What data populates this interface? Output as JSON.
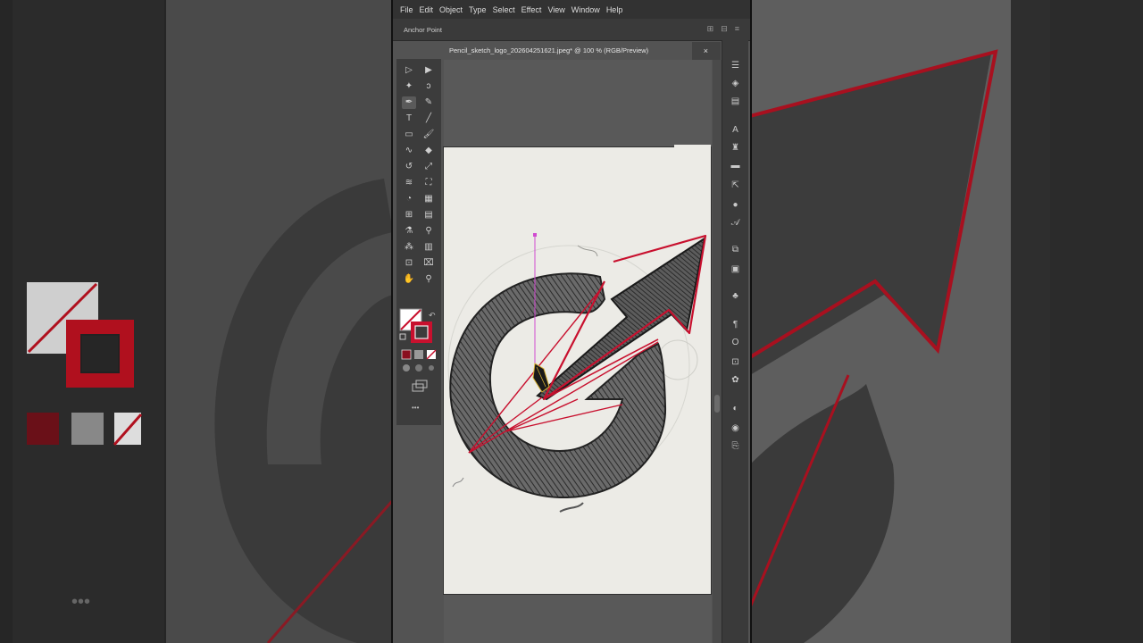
{
  "menubar": {
    "items": [
      "File",
      "Edit",
      "Object",
      "Type",
      "Select",
      "Effect",
      "View",
      "Window",
      "Help"
    ]
  },
  "control_bar": {
    "label": "Anchor Point"
  },
  "document": {
    "tab_title": "Pencil_sketch_logo_202604251621.jpeg* @ 100 % (RGB/Preview)",
    "close_glyph": "×"
  },
  "toolbar": {
    "tools": [
      {
        "name": "selection-tool-icon",
        "glyph": "▷"
      },
      {
        "name": "direct-selection-tool-icon",
        "glyph": "▶"
      },
      {
        "name": "magic-wand-tool-icon",
        "glyph": "✦"
      },
      {
        "name": "lasso-tool-icon",
        "glyph": "ↄ"
      },
      {
        "name": "pen-tool-icon",
        "glyph": "✒"
      },
      {
        "name": "curvature-tool-icon",
        "glyph": "✎"
      },
      {
        "name": "type-tool-icon",
        "glyph": "T"
      },
      {
        "name": "line-tool-icon",
        "glyph": "╱"
      },
      {
        "name": "rectangle-tool-icon",
        "glyph": "▭"
      },
      {
        "name": "paintbrush-tool-icon",
        "glyph": "🖌"
      },
      {
        "name": "shaper-tool-icon",
        "glyph": "∿"
      },
      {
        "name": "eraser-tool-icon",
        "glyph": "◆"
      },
      {
        "name": "rotate-tool-icon",
        "glyph": "↺"
      },
      {
        "name": "scale-tool-icon",
        "glyph": "⤢"
      },
      {
        "name": "warp-tool-icon",
        "glyph": "≋"
      },
      {
        "name": "free-transform-tool-icon",
        "glyph": "⛶"
      },
      {
        "name": "shape-builder-tool-icon",
        "glyph": "◔"
      },
      {
        "name": "perspective-grid-tool-icon",
        "glyph": "▦"
      },
      {
        "name": "mesh-tool-icon",
        "glyph": "⊞"
      },
      {
        "name": "gradient-tool-icon",
        "glyph": "▤"
      },
      {
        "name": "eyedropper-tool-icon",
        "glyph": "⚗"
      },
      {
        "name": "blend-tool-icon",
        "glyph": "⚲"
      },
      {
        "name": "symbol-sprayer-tool-icon",
        "glyph": "⁂"
      },
      {
        "name": "column-graph-tool-icon",
        "glyph": "▥"
      },
      {
        "name": "artboard-tool-icon",
        "glyph": "⊡"
      },
      {
        "name": "slice-tool-icon",
        "glyph": "⌧"
      },
      {
        "name": "hand-tool-icon",
        "glyph": "✋"
      },
      {
        "name": "zoom-tool-icon",
        "glyph": "⚲"
      }
    ],
    "more_glyph": "•••"
  },
  "colors": {
    "stroke_red": "#c8102e",
    "chrome_dark": "#323232",
    "canvas_gray": "#595959",
    "paper": "#ecebe6",
    "guide_magenta": "#d04bd0"
  },
  "right_dock": {
    "icons": [
      "properties-icon",
      "layers-icon",
      "align-icon",
      "character-icon",
      "libraries-icon",
      "gradient-icon",
      "export-icon",
      "stroke-icon",
      "type-icon",
      "pathfinder-icon",
      "image-trace-icon",
      "symbols-icon",
      "paragraph-icon",
      "opentype-icon",
      "transform-icon",
      "swatches-icon",
      "appearance-icon",
      "color-icon",
      "links-icon"
    ]
  }
}
